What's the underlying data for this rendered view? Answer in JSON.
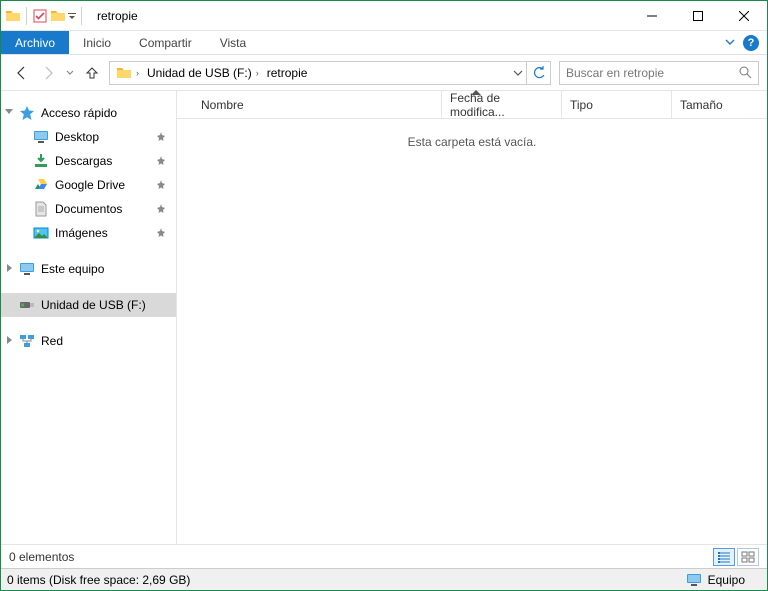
{
  "window": {
    "title": "retropie"
  },
  "ribbon": {
    "file": "Archivo",
    "tabs": [
      "Inicio",
      "Compartir",
      "Vista"
    ]
  },
  "address": {
    "drive_label": "Unidad de USB (F:)",
    "folder": "retropie"
  },
  "search": {
    "placeholder": "Buscar en retropie"
  },
  "nav_pane": {
    "quick_access": {
      "label": "Acceso rápido",
      "items": [
        {
          "label": "Desktop",
          "icon": "monitor",
          "pinned": true
        },
        {
          "label": "Descargas",
          "icon": "download",
          "pinned": true
        },
        {
          "label": "Google Drive",
          "icon": "gdrive",
          "pinned": true
        },
        {
          "label": "Documentos",
          "icon": "document",
          "pinned": true
        },
        {
          "label": "Imágenes",
          "icon": "images",
          "pinned": true
        }
      ]
    },
    "this_pc": {
      "label": "Este equipo"
    },
    "usb": {
      "label": "Unidad de USB (F:)"
    },
    "network": {
      "label": "Red"
    }
  },
  "columns": {
    "name": "Nombre",
    "date": "Fecha de modifica...",
    "type": "Tipo",
    "size": "Tamaño"
  },
  "content": {
    "empty": "Esta carpeta está vacía."
  },
  "status1": {
    "items": "0 elementos"
  },
  "status2": {
    "left": "0 items (Disk free space: 2,69 GB)",
    "right": "Equipo"
  }
}
